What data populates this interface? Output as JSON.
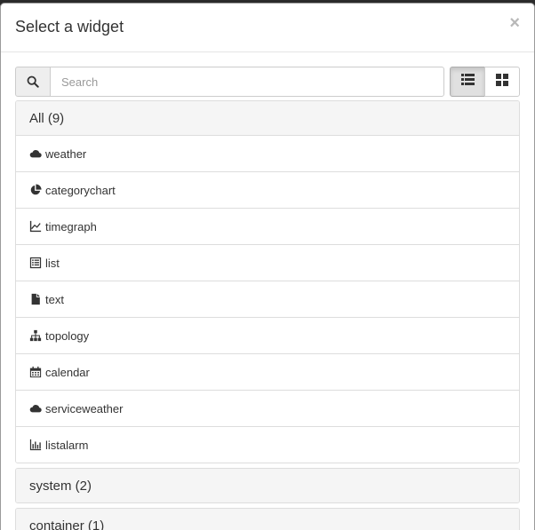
{
  "modal": {
    "title": "Select a widget",
    "close": "×"
  },
  "search": {
    "placeholder": "Search",
    "value": ""
  },
  "view": {
    "list_icon": "list-icon",
    "grid_icon": "grid-icon",
    "active": "list"
  },
  "groups": [
    {
      "label": "All (9)",
      "expanded": true,
      "items": [
        {
          "label": "weather",
          "icon": "cloud-icon"
        },
        {
          "label": "categorychart",
          "icon": "pie-chart-icon"
        },
        {
          "label": "timegraph",
          "icon": "line-chart-icon"
        },
        {
          "label": "list",
          "icon": "list-alt-icon"
        },
        {
          "label": "text",
          "icon": "file-icon"
        },
        {
          "label": "topology",
          "icon": "sitemap-icon"
        },
        {
          "label": "calendar",
          "icon": "calendar-icon"
        },
        {
          "label": "serviceweather",
          "icon": "cloud-icon"
        },
        {
          "label": "listalarm",
          "icon": "bar-chart-icon"
        }
      ]
    },
    {
      "label": "system (2)",
      "expanded": false
    },
    {
      "label": "container (1)",
      "expanded": false
    }
  ]
}
